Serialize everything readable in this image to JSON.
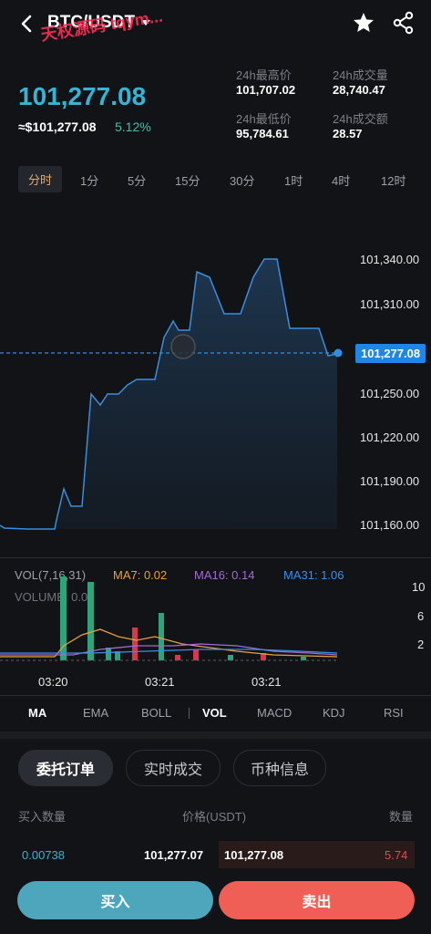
{
  "header": {
    "pair": "BTC/USDT",
    "watermark": "天权源码 tqym..."
  },
  "price": {
    "last": "101,277.08",
    "usd": "≈$101,277.08",
    "change": "5.12%"
  },
  "stats": {
    "high_label": "24h最高价",
    "high_value": "101,707.02",
    "low_label": "24h最低价",
    "low_value": "95,784.61",
    "vol_label": "24h成交量",
    "vol_value": "28,740.47",
    "amount_label": "24h成交额",
    "amount_value": "28.57"
  },
  "time_tabs": [
    "分时",
    "1分",
    "5分",
    "15分",
    "30分",
    "1时",
    "4时",
    "12时"
  ],
  "price_axis": [
    "101,340.00",
    "101,310.00",
    "101,250.00",
    "101,220.00",
    "101,190.00",
    "101,160.00"
  ],
  "current_price_tag": "101,277.08",
  "volume": {
    "vol_params": "VOL(7,16,31)",
    "ma7": "MA7: 0.02",
    "ma16": "MA16: 0.14",
    "ma31": "MA31: 1.06",
    "volume_value": "VOLUME: 0.00",
    "axis": [
      "10",
      "6",
      "2"
    ],
    "times": [
      "03:20",
      "03:21",
      "03:21"
    ]
  },
  "indicator_tabs": [
    "MA",
    "EMA",
    "BOLL",
    "VOL",
    "MACD",
    "KDJ",
    "RSI"
  ],
  "sections": [
    "委托订单",
    "实时成交",
    "币种信息"
  ],
  "table": {
    "col_qty": "买入数量",
    "col_price": "价格(USDT)",
    "col_amount": "数量",
    "row_buy_qty": "0.00738",
    "row_buy_price": "101,277.07",
    "row_sell_price": "101,277.08",
    "row_sell_qty": "5.74"
  },
  "buttons": {
    "buy": "买入",
    "sell": "卖出"
  },
  "colors": {
    "accent_blue": "#37b3d6",
    "up_green": "#36c3b0",
    "down_red": "#e5484d",
    "buy_button": "#4ea6bd",
    "sell_button": "#ef5f55"
  }
}
